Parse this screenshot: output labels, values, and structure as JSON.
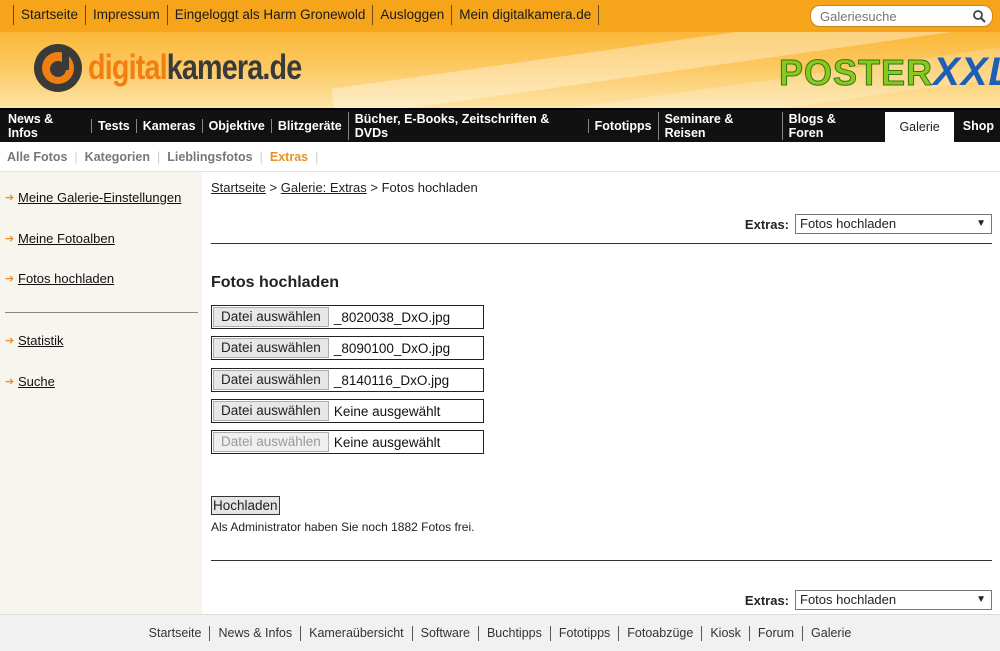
{
  "top_links": [
    "Startseite",
    "Impressum",
    "Eingeloggt als Harm Gronewold",
    "Ausloggen",
    "Mein digitalkamera.de"
  ],
  "search": {
    "placeholder": "Galeriesuche"
  },
  "logo": {
    "part1": "digital",
    "part2": "kamera.de"
  },
  "ad": {
    "part1": "POSTER",
    "part2": "XXL"
  },
  "main_nav": [
    "News & Infos",
    "Tests",
    "Kameras",
    "Objektive",
    "Blitzgeräte",
    "Bücher, E-Books, Zeitschriften & DVDs",
    "Fototipps",
    "Seminare & Reisen",
    "Blogs & Foren",
    "Galerie",
    "Shop"
  ],
  "main_nav_active": "Galerie",
  "sub_nav": [
    "Alle Fotos",
    "Kategorien",
    "Lieblingsfotos",
    "Extras"
  ],
  "sub_nav_active": "Extras",
  "sidebar": {
    "items": [
      "Meine Galerie-Einstellungen",
      "Meine Fotoalben",
      "Fotos hochladen"
    ],
    "items2": [
      "Statistik",
      "Suche"
    ]
  },
  "breadcrumb": {
    "home": "Startseite",
    "gallery": "Galerie: Extras",
    "current": "Fotos hochladen",
    "sep": ">"
  },
  "extras": {
    "label": "Extras:",
    "selected": "Fotos hochladen"
  },
  "page_title": "Fotos hochladen",
  "file_inputs": [
    {
      "button": "Datei auswählen",
      "file": "_8020038_DxO.jpg",
      "disabled": false
    },
    {
      "button": "Datei auswählen",
      "file": "_8090100_DxO.jpg",
      "disabled": false
    },
    {
      "button": "Datei auswählen",
      "file": "_8140116_DxO.jpg",
      "disabled": false
    },
    {
      "button": "Datei auswählen",
      "file": "Keine ausgewählt",
      "disabled": false
    },
    {
      "button": "Datei auswählen",
      "file": "Keine ausgewählt",
      "disabled": true
    }
  ],
  "upload_button": "Hochladen",
  "note": "Als Administrator haben Sie noch 1882 Fotos frei.",
  "footer_links": [
    "Startseite",
    "News & Infos",
    "Kameraübersicht",
    "Software",
    "Buchtipps",
    "Fototipps",
    "Fotoabzüge",
    "Kiosk",
    "Forum",
    "Galerie"
  ],
  "colors": {
    "accent": "#f6a51a",
    "nav": "#111111",
    "link_active": "#e8902a"
  }
}
